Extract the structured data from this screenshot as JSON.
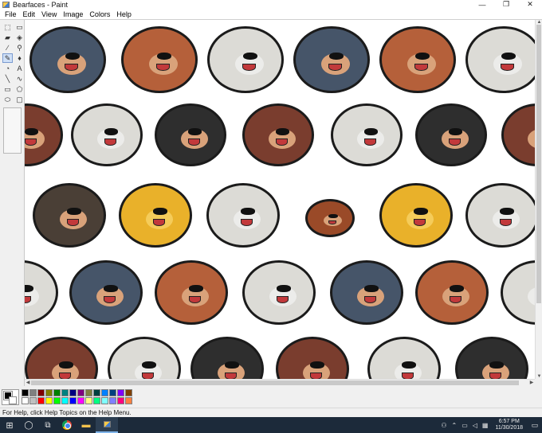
{
  "window": {
    "title": "Bearfaces - Paint",
    "minimize_glyph": "—",
    "maximize_glyph": "❐",
    "close_glyph": "✕"
  },
  "menu": [
    "File",
    "Edit",
    "View",
    "Image",
    "Colors",
    "Help"
  ],
  "tools": [
    {
      "name": "free-form-select-icon",
      "glyph": "⬚"
    },
    {
      "name": "rectangle-select-icon",
      "glyph": "▭"
    },
    {
      "name": "eraser-icon",
      "glyph": "▰"
    },
    {
      "name": "fill-bucket-icon",
      "glyph": "◈"
    },
    {
      "name": "color-picker-icon",
      "glyph": "∕"
    },
    {
      "name": "magnifier-icon",
      "glyph": "⚲"
    },
    {
      "name": "pencil-icon",
      "glyph": "✎"
    },
    {
      "name": "brush-icon",
      "glyph": "♦"
    },
    {
      "name": "airbrush-icon",
      "glyph": "◔"
    },
    {
      "name": "text-icon",
      "glyph": "A"
    },
    {
      "name": "line-icon",
      "glyph": "╲"
    },
    {
      "name": "curve-icon",
      "glyph": "∿"
    },
    {
      "name": "rectangle-icon",
      "glyph": "▭"
    },
    {
      "name": "polygon-icon",
      "glyph": "⬠"
    },
    {
      "name": "ellipse-icon",
      "glyph": "⬭"
    },
    {
      "name": "rounded-rectangle-icon",
      "glyph": "▢"
    }
  ],
  "active_tool_index": 6,
  "palette": {
    "foreground": "#000000",
    "background": "#ffffff",
    "colors": [
      "#000000",
      "#808080",
      "#800000",
      "#808000",
      "#008000",
      "#008080",
      "#000080",
      "#800080",
      "#808040",
      "#004040",
      "#0080ff",
      "#004080",
      "#8000ff",
      "#804000",
      "#ffffff",
      "#c0c0c0",
      "#ff0000",
      "#ffff00",
      "#00ff00",
      "#00ffff",
      "#0000ff",
      "#ff00ff",
      "#ffff80",
      "#00ff80",
      "#80ffff",
      "#8080ff",
      "#ff0080",
      "#ff8040"
    ]
  },
  "status": {
    "text": "For Help, click Help Topics on the Help Menu."
  },
  "taskbar": {
    "start_icon": "windows-start-icon",
    "time": "6:57 PM",
    "date": "11/30/2018"
  },
  "bear_colors": {
    "navy": "#465569",
    "brown": "#b5603a",
    "white": "#dcdbd6",
    "black": "#2e2e2e",
    "darkred": "#7a3d2e",
    "dark": "#4a3f36",
    "gold": "#e9b12a",
    "otter": "#9a4a28"
  }
}
